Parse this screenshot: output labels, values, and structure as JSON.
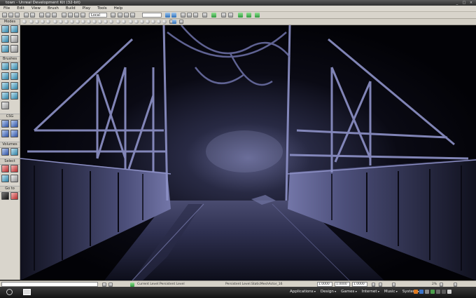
{
  "window": {
    "title": "town - Unreal Development Kit (32-bit)",
    "controls": [
      "_",
      "□",
      "×"
    ]
  },
  "menu": [
    "File",
    "Edit",
    "View",
    "Brush",
    "Build",
    "Play",
    "Tools",
    "Help"
  ],
  "toolbar": {
    "coord_system": "Local"
  },
  "sidebar": {
    "sections": {
      "modes": "Modes",
      "brushes": "Brushes",
      "csg": "CSG",
      "volumes": "Volumes",
      "select": "Select",
      "goto": "Go to"
    }
  },
  "status": {
    "current_level_label": "Current Level:",
    "current_level_value": "Persistent Level",
    "selection": "Persistent Level.StaticMeshActor_16",
    "grid_values": [
      "1.0000",
      "1.0000",
      "1.0000"
    ],
    "zoom": "2%"
  },
  "taskbar": {
    "menus": [
      "Applications",
      "Design",
      "Games",
      "Internet",
      "Music",
      "System"
    ]
  },
  "colors": {
    "viewport_tint": "#7c80c0",
    "chrome": "#d9d5cc",
    "taskbar": "#1e1e1e",
    "accent_blue": "#2d6fb8",
    "accent_green": "#2e9a3e"
  }
}
